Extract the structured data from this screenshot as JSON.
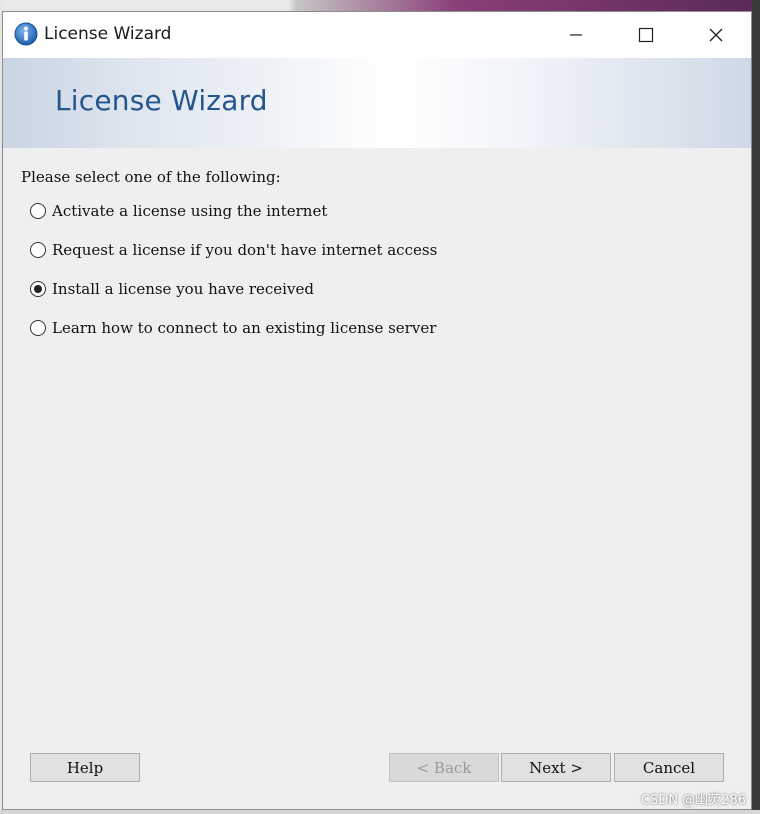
{
  "window": {
    "title": "License Wizard",
    "icon": "info-icon"
  },
  "controls": {
    "minimize_icon": "minimize-icon",
    "maximize_icon": "maximize-icon",
    "close_icon": "close-icon"
  },
  "banner": {
    "title": "License Wizard"
  },
  "content": {
    "prompt": "Please select one of the following:",
    "options": [
      {
        "label": "Activate a license using the internet",
        "selected": false
      },
      {
        "label": "Request a license if you don't have internet access",
        "selected": false
      },
      {
        "label": "Install a license you have received",
        "selected": true
      },
      {
        "label": "Learn how to connect to an existing license server",
        "selected": false
      }
    ]
  },
  "buttons": {
    "help": "Help",
    "back": "< Back",
    "next": "Next >",
    "cancel": "Cancel"
  },
  "watermark": "CSDN @幽荧286",
  "colors": {
    "banner_title": "#24568e",
    "window_bg": "#efefef"
  }
}
